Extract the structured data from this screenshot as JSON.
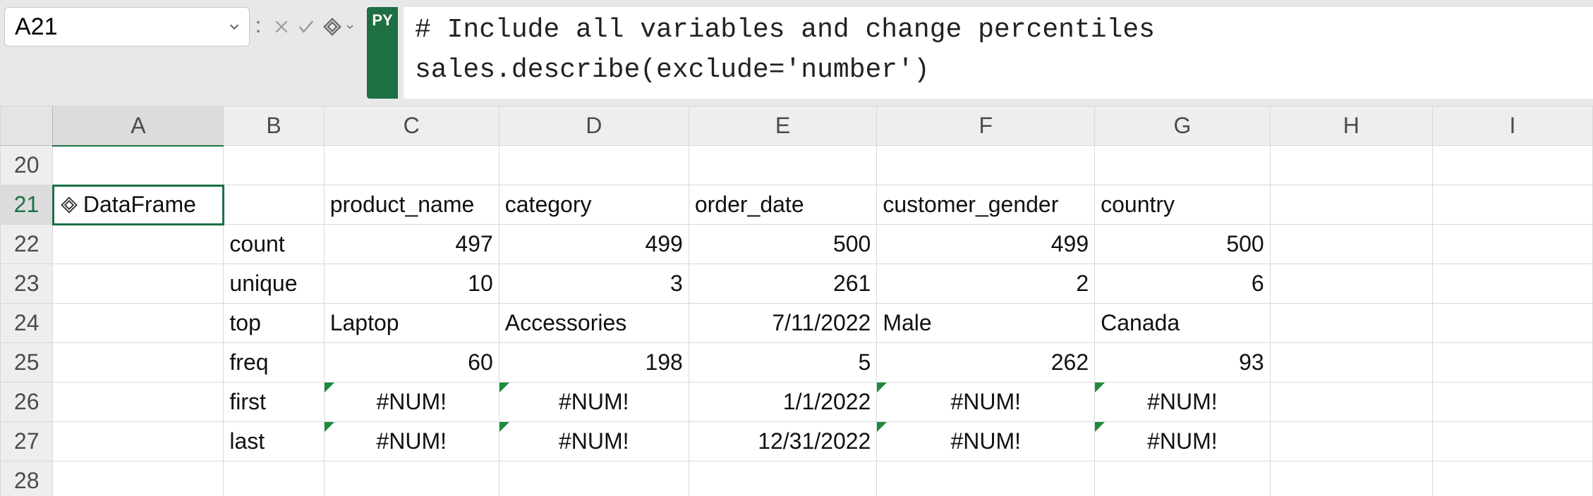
{
  "formula_bar": {
    "cell_ref": "A21",
    "py_badge": "PY",
    "code_line1": "# Include all variables and change percentiles",
    "code_line2": "sales.describe(exclude='number')"
  },
  "columns": [
    "A",
    "B",
    "C",
    "D",
    "E",
    "F",
    "G",
    "H",
    "I"
  ],
  "row_numbers": [
    "20",
    "21",
    "22",
    "23",
    "24",
    "25",
    "26",
    "27",
    "28"
  ],
  "cells": {
    "A21_label": "DataFrame",
    "C21": "product_name",
    "D21": "category",
    "E21": "order_date",
    "F21": "customer_gender",
    "G21": "country",
    "B22": "count",
    "C22": "497",
    "D22": "499",
    "E22": "500",
    "F22": "499",
    "G22": "500",
    "B23": "unique",
    "C23": "10",
    "D23": "3",
    "E23": "261",
    "F23": "2",
    "G23": "6",
    "B24": "top",
    "C24": "Laptop",
    "D24": "Accessories",
    "E24": "7/11/2022",
    "F24": "Male",
    "G24": "Canada",
    "B25": "freq",
    "C25": "60",
    "D25": "198",
    "E25": "5",
    "F25": "262",
    "G25": "93",
    "B26": "first",
    "C26": "#NUM!",
    "D26": "#NUM!",
    "E26": "1/1/2022",
    "F26": "#NUM!",
    "G26": "#NUM!",
    "B27": "last",
    "C27": "#NUM!",
    "D27": "#NUM!",
    "E27": "12/31/2022",
    "F27": "#NUM!",
    "G27": "#NUM!"
  },
  "chart_data": {
    "type": "table",
    "title": "sales.describe(exclude='number')",
    "columns": [
      "product_name",
      "category",
      "order_date",
      "customer_gender",
      "country"
    ],
    "index": [
      "count",
      "unique",
      "top",
      "freq",
      "first",
      "last"
    ],
    "data": [
      [
        497,
        499,
        500,
        499,
        500
      ],
      [
        10,
        3,
        261,
        2,
        6
      ],
      [
        "Laptop",
        "Accessories",
        "7/11/2022",
        "Male",
        "Canada"
      ],
      [
        60,
        198,
        5,
        262,
        93
      ],
      [
        "#NUM!",
        "#NUM!",
        "1/1/2022",
        "#NUM!",
        "#NUM!"
      ],
      [
        "#NUM!",
        "#NUM!",
        "12/31/2022",
        "#NUM!",
        "#NUM!"
      ]
    ]
  }
}
